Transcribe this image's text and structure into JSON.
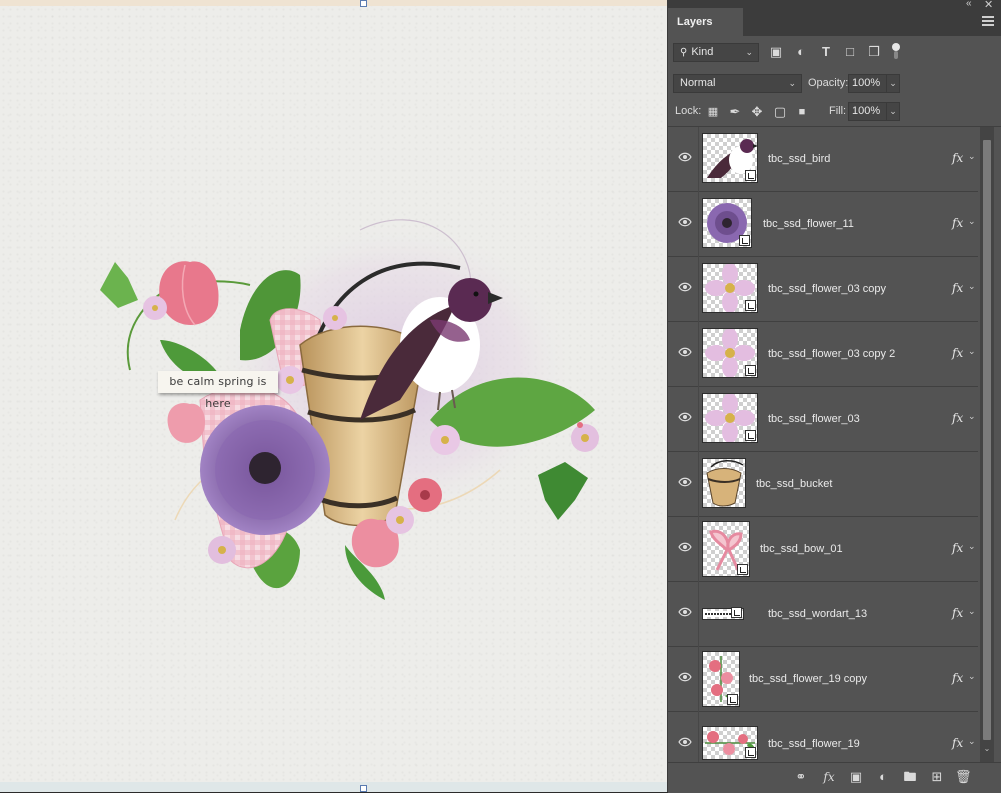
{
  "panel": {
    "tab_label": "Layers",
    "filter": {
      "value": "Kind"
    },
    "filter_icons": [
      "image-filter-icon",
      "adjustment-filter-icon",
      "type-filter-icon",
      "shape-filter-icon",
      "smart-object-filter-icon",
      "filter-toggle-icon"
    ],
    "blend_mode": {
      "value": "Normal"
    },
    "opacity": {
      "label": "Opacity:",
      "value": "100%"
    },
    "lock": {
      "label": "Lock:",
      "icons": [
        "lock-transparent-pixels-icon",
        "lock-image-pixels-icon",
        "lock-position-icon",
        "lock-artboard-icon",
        "lock-all-icon"
      ]
    },
    "fill": {
      "label": "Fill:",
      "value": "100%"
    },
    "layers": [
      {
        "name": "tbc_ssd_bird",
        "thumb": "bird",
        "smart": true,
        "fx": "fx"
      },
      {
        "name": "tbc_ssd_flower_11",
        "thumb": "purple-flower",
        "smart": true,
        "fx": "fx"
      },
      {
        "name": "tbc_ssd_flower_03 copy",
        "thumb": "lilac-flower",
        "smart": true,
        "fx": "fx"
      },
      {
        "name": "tbc_ssd_flower_03 copy 2",
        "thumb": "lilac-flower",
        "smart": true,
        "fx": "fx"
      },
      {
        "name": "tbc_ssd_flower_03",
        "thumb": "lilac-flower",
        "smart": true,
        "fx": "fx"
      },
      {
        "name": "tbc_ssd_bucket",
        "thumb": "bucket",
        "smart": false,
        "fx": ""
      },
      {
        "name": "tbc_ssd_bow_01",
        "thumb": "bow",
        "smart": true,
        "fx": "fx"
      },
      {
        "name": "tbc_ssd_wordart_13",
        "thumb": "wordart",
        "smart": true,
        "fx": "fx"
      },
      {
        "name": "tbc_ssd_flower_19 copy",
        "thumb": "pink-sprig",
        "smart": true,
        "fx": "fx"
      },
      {
        "name": "tbc_ssd_flower_19",
        "thumb": "pink-sprig-wide",
        "smart": true,
        "fx": "fx"
      }
    ],
    "footer_icons": [
      "link-layers-icon",
      "add-layer-style-icon",
      "add-mask-icon",
      "adjustment-layer-icon",
      "new-group-icon",
      "new-layer-icon",
      "delete-layer-icon"
    ]
  },
  "canvas": {
    "wordart_text": "be calm spring is here"
  },
  "colors": {
    "panel_bg": "#535353",
    "canvas_paper": "#ededea",
    "accent_purple": "#7a5aa0",
    "leaf_green": "#4e9a3a",
    "tulip_pink": "#e8788c"
  }
}
